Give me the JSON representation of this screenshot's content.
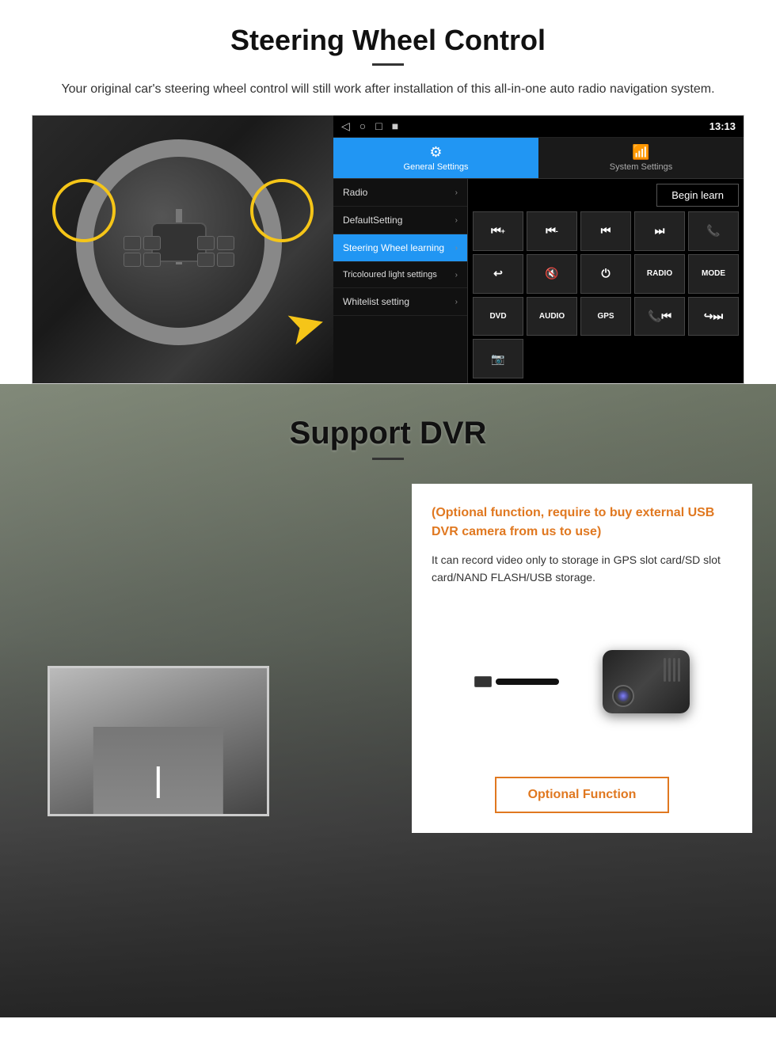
{
  "steering_section": {
    "title": "Steering Wheel Control",
    "subtitle": "Your original car's steering wheel control will still work after installation of this all-in-one auto radio navigation system.",
    "ui": {
      "statusbar": {
        "time": "13:13",
        "nav_icons": [
          "◁",
          "○",
          "□",
          "■"
        ]
      },
      "tabs": [
        {
          "label": "General Settings",
          "active": true,
          "icon": "⚙"
        },
        {
          "label": "System Settings",
          "active": false,
          "icon": "📶"
        }
      ],
      "menu_items": [
        {
          "label": "Radio",
          "active": false
        },
        {
          "label": "DefaultSetting",
          "active": false
        },
        {
          "label": "Steering Wheel learning",
          "active": true
        },
        {
          "label": "Tricoloured light settings",
          "active": false
        },
        {
          "label": "Whitelist setting",
          "active": false
        }
      ],
      "begin_learn_btn": "Begin learn",
      "control_buttons_row1": [
        "⏮+",
        "⏮-",
        "⏮",
        "⏭",
        "📞"
      ],
      "control_buttons_row2": [
        "↩",
        "🔇",
        "⏻",
        "RADIO",
        "MODE"
      ],
      "control_buttons_row3": [
        "DVD",
        "AUDIO",
        "GPS",
        "📞⏮",
        "↪⏭"
      ],
      "control_buttons_row4": [
        "📷"
      ]
    }
  },
  "dvr_section": {
    "title": "Support DVR",
    "optional_text": "(Optional function, require to buy external USB DVR camera from us to use)",
    "desc": "It can record video only to storage in GPS slot card/SD slot card/NAND FLASH/USB storage.",
    "optional_func_btn": "Optional Function"
  }
}
